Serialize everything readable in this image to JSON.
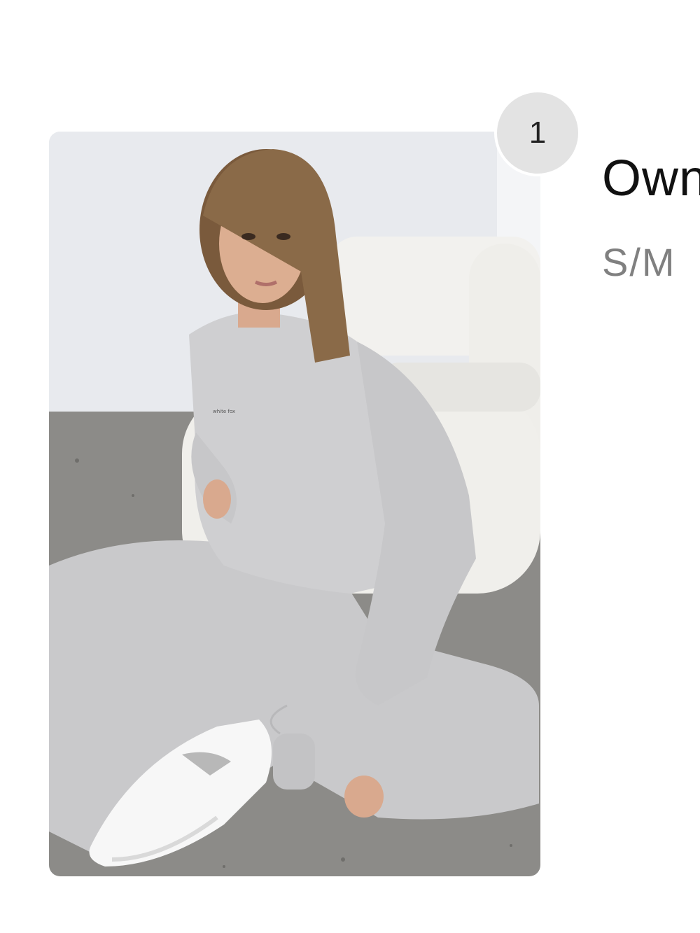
{
  "cart_item": {
    "quantity": "1",
    "title": "Own",
    "size": "S/M",
    "image": {
      "name": "product-photo",
      "print_text": "white fox"
    }
  },
  "colors": {
    "badge_bg": "#e3e3e3",
    "title": "#111111",
    "size": "#808080",
    "outfit": "#cfcfd1"
  }
}
